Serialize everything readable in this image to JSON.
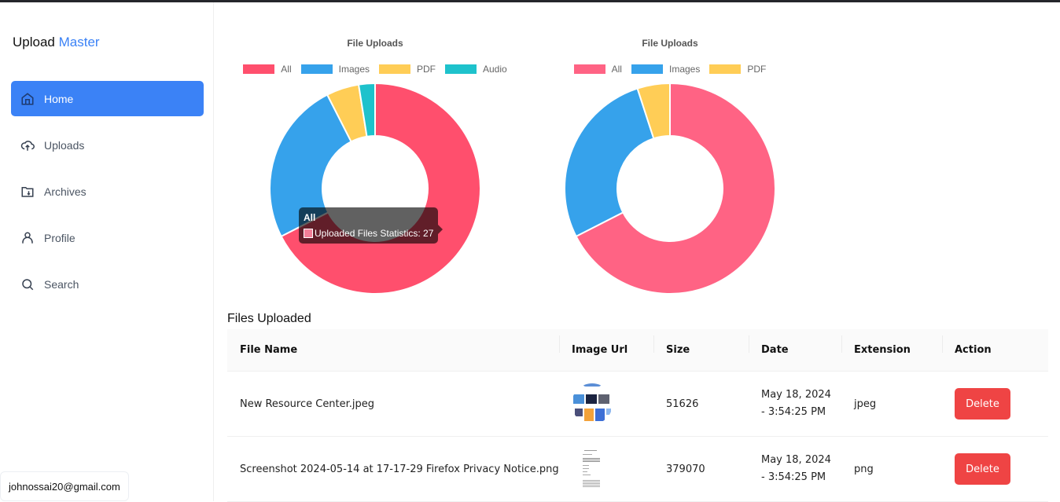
{
  "brand": {
    "name": "Upload",
    "accent": "Master"
  },
  "nav": [
    {
      "label": "Home",
      "icon": "home-icon",
      "active": true
    },
    {
      "label": "Uploads",
      "icon": "cloud-upload-icon",
      "active": false
    },
    {
      "label": "Archives",
      "icon": "folder-download-icon",
      "active": false
    },
    {
      "label": "Profile",
      "icon": "user-icon",
      "active": false
    },
    {
      "label": "Search",
      "icon": "search-icon",
      "active": false
    }
  ],
  "user": {
    "email": "johnossai20@gmail.com"
  },
  "colors": {
    "accent": "#3b82f6",
    "danger": "#ef4444",
    "all": "#ff4f6d",
    "images": "#36a2eb",
    "pdf": "#ffcd56",
    "audio": "#1ec2cc"
  },
  "chart_data": [
    {
      "type": "pie",
      "variant": "doughnut",
      "title": "File Uploads",
      "categories": [
        "All",
        "Images",
        "PDF",
        "Audio"
      ],
      "values": [
        27,
        10,
        2,
        1
      ],
      "colors": [
        "#ff4f6d",
        "#36a2eb",
        "#ffcd56",
        "#1ec2cc"
      ],
      "legend": "top",
      "tooltip": {
        "title": "All",
        "label": "Uploaded Files Statistics: 27"
      }
    },
    {
      "type": "pie",
      "variant": "doughnut",
      "title": "File Uploads",
      "categories": [
        "All",
        "Images",
        "PDF"
      ],
      "values": [
        27,
        11,
        2
      ],
      "colors": [
        "#ff6384",
        "#36a2eb",
        "#ffcd56"
      ],
      "legend": "top"
    }
  ],
  "table": {
    "title": "Files Uploaded",
    "headers": [
      "File Name",
      "Image Url",
      "Size",
      "Date",
      "Extension",
      "Action"
    ],
    "rows": [
      {
        "name": "New Resource Center.jpeg",
        "thumb": "image-thumbnail",
        "size": "51626",
        "date1": "May 18, 2024",
        "date2": "- 3:54:25 PM",
        "ext": "jpeg",
        "action": "Delete"
      },
      {
        "name": "Screenshot 2024-05-14 at 17-17-29 Firefox Privacy Notice.png",
        "thumb": "document-thumbnail",
        "size": "379070",
        "date1": "May 18, 2024",
        "date2": "- 3:54:25 PM",
        "ext": "png",
        "action": "Delete"
      }
    ]
  }
}
